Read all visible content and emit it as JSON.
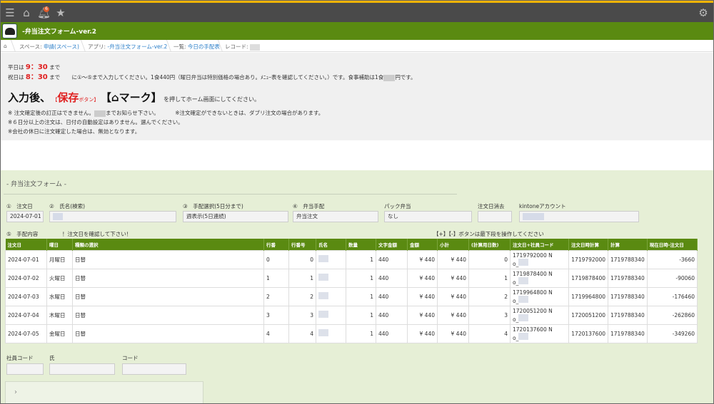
{
  "header": {
    "notification_count": "6",
    "app_title": "-弁当注文フォーム-ver.2"
  },
  "breadcrumb": {
    "space_prefix": "スペース: ",
    "space": "申請(スペース)",
    "app_prefix": "アプリ: ",
    "app": "-弁当注文フォーム-ver.2",
    "list_prefix": "一覧: ",
    "list": "今日の手配表",
    "record_prefix": "レコード: "
  },
  "notice": {
    "weekday_prefix": "平日は",
    "weekday_time": "9：30",
    "weekday_suffix": "まで",
    "holiday_prefix": "祝日は",
    "holiday_time": "8：30",
    "holiday_suffix": "まで",
    "holiday_note": "に①～⑤まで入力してください。1食440円（曜日弁当は特別価格の場合あり。ﾒﾆｭｰ表を確認してください。）です。食事補助は1食",
    "holiday_note_end": "円です。",
    "big_prefix": "入力後、",
    "save_small_open": "【",
    "save_word": "保存",
    "save_small_close": "ボタン】",
    "mark_open": "【",
    "mark_word": "マーク】",
    "big_suffix": "を押してホーム画面にしてください。",
    "note1a": "※ 注文確定後の訂正はできません。",
    "note1b": "までお知らせ下さい。",
    "note1c": "※注文確定ができないときは、ダブリ注文の場合があります。",
    "note2": "※６日分以上の注文は、日付の自動設定はありません。選んでください。",
    "note3": "※会社の休日に注文確定した場合は、無効となります。"
  },
  "form": {
    "title": "- 弁当注文フォーム -",
    "fields": {
      "order_date_label": "①　注文日",
      "order_date": "2024-07-01",
      "name_label": "②　氏名(検索)",
      "arrange_label": "③　手配選択(5日分まで)",
      "arrange_value": "週表示(5日連続)",
      "bento_label": "④　弁当手配",
      "bento_value": "弁当注文",
      "pack_label": "パック弁当",
      "pack_value": "なし",
      "cancel_label": "注文日消去",
      "account_label": "kintoneアカウント",
      "content_label": "⑤　手配内容",
      "content_hint": "！注文日を確認して下さい！",
      "table_hint": "【+】【-】ボタンは最下段を操作してください"
    },
    "table": {
      "headers": [
        "注文日",
        "曜日",
        "種類の選択",
        "行番",
        "行番号",
        "氏名",
        "数量",
        "文字金額",
        "金額",
        "小計",
        "(計算用日数)",
        "注文日+社員コード",
        "注文日時計算",
        "計算",
        "現在日時-注文日"
      ],
      "rows": [
        [
          "2024-07-01",
          "月曜日",
          "日替",
          "0",
          "0",
          "",
          "1",
          "440",
          "¥ 440",
          "¥ 440",
          "0",
          "1719792000  N",
          "o_",
          "1719792000",
          "1719788340",
          "-3660"
        ],
        [
          "2024-07-02",
          "火曜日",
          "日替",
          "1",
          "1",
          "",
          "1",
          "440",
          "¥ 440",
          "¥ 440",
          "1",
          "1719878400  N",
          "o_",
          "1719878400",
          "1719788340",
          "-90060"
        ],
        [
          "2024-07-03",
          "水曜日",
          "日替",
          "2",
          "2",
          "",
          "1",
          "440",
          "¥ 440",
          "¥ 440",
          "2",
          "1719964800  N",
          "o_",
          "1719964800",
          "1719788340",
          "-176460"
        ],
        [
          "2024-07-04",
          "木曜日",
          "日替",
          "3",
          "3",
          "",
          "1",
          "440",
          "¥ 440",
          "¥ 440",
          "3",
          "1720051200  N",
          "o_",
          "1720051200",
          "1719788340",
          "-262860"
        ],
        [
          "2024-07-05",
          "金曜日",
          "日替",
          "4",
          "4",
          "",
          "1",
          "440",
          "¥ 440",
          "¥ 440",
          "4",
          "1720137600  N",
          "o_",
          "1720137600",
          "1719788340",
          "-349260"
        ]
      ]
    },
    "bottom": {
      "emp_code_label": "社員コード",
      "surname_label": "氏",
      "code_label": "コード",
      "expander": "›"
    }
  }
}
